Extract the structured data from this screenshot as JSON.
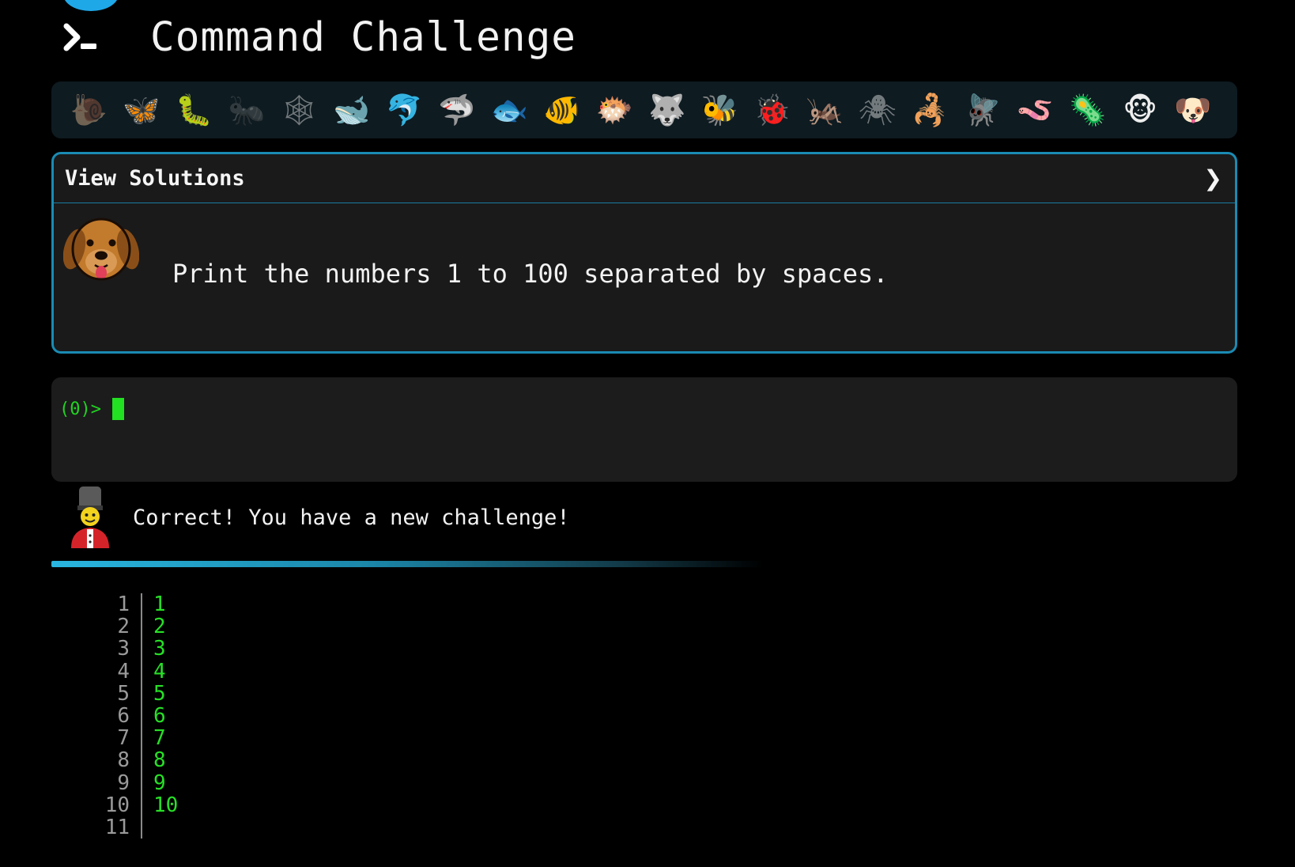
{
  "header": {
    "title": "Command Challenge",
    "logo_icon": "terminal-prompt-icon"
  },
  "emoji_bar": {
    "items": [
      {
        "glyph": "🐌",
        "name": "snail",
        "dim": true
      },
      {
        "glyph": "🦋",
        "name": "butterfly",
        "dim": false
      },
      {
        "glyph": "🐛",
        "name": "caterpillar",
        "dim": false
      },
      {
        "glyph": "🐜",
        "name": "ant",
        "dim": true
      },
      {
        "glyph": "🕸",
        "name": "spider-web",
        "dim": true
      },
      {
        "glyph": "🐋",
        "name": "whale",
        "dim": false
      },
      {
        "glyph": "🐬",
        "name": "dolphin",
        "dim": false
      },
      {
        "glyph": "🦈",
        "name": "shark",
        "dim": false
      },
      {
        "glyph": "🐟",
        "name": "fish",
        "dim": false
      },
      {
        "glyph": "🐠",
        "name": "tropical-fish",
        "dim": false
      },
      {
        "glyph": "🐡",
        "name": "blowfish",
        "dim": false
      },
      {
        "glyph": "🐺",
        "name": "wolf",
        "dim": false
      },
      {
        "glyph": "🐝",
        "name": "bee",
        "dim": false
      },
      {
        "glyph": "🐞",
        "name": "ladybug",
        "dim": false
      },
      {
        "glyph": "🦗",
        "name": "cricket",
        "dim": false
      },
      {
        "glyph": "🕷",
        "name": "spider",
        "dim": true
      },
      {
        "glyph": "🦂",
        "name": "scorpion",
        "dim": false
      },
      {
        "glyph": "🪰",
        "name": "fly",
        "dim": false
      },
      {
        "glyph": "🪱",
        "name": "worm",
        "dim": false
      },
      {
        "glyph": "🦠",
        "name": "microbe",
        "dim": false
      },
      {
        "glyph": "🐵",
        "name": "monkey",
        "dim": false
      },
      {
        "glyph": "🐶",
        "name": "dog",
        "dim": false
      }
    ]
  },
  "solutions": {
    "label": "View Solutions",
    "chevron": "❯",
    "avatar_icon": "dog-face-icon",
    "challenge": "Print the numbers 1 to 100 separated by spaces."
  },
  "terminal": {
    "prompt": "(0)>",
    "input_value": ""
  },
  "feedback": {
    "icon": "guard-icon",
    "message": "Correct! You have a new challenge!",
    "progress": 0.55
  },
  "output": {
    "line_numbers": [
      "1",
      "2",
      "3",
      "4",
      "5",
      "6",
      "7",
      "8",
      "9",
      "10",
      "11"
    ],
    "lines": [
      "1",
      "2",
      "3",
      "4",
      "5",
      "6",
      "7",
      "8",
      "9",
      "10",
      ""
    ]
  }
}
